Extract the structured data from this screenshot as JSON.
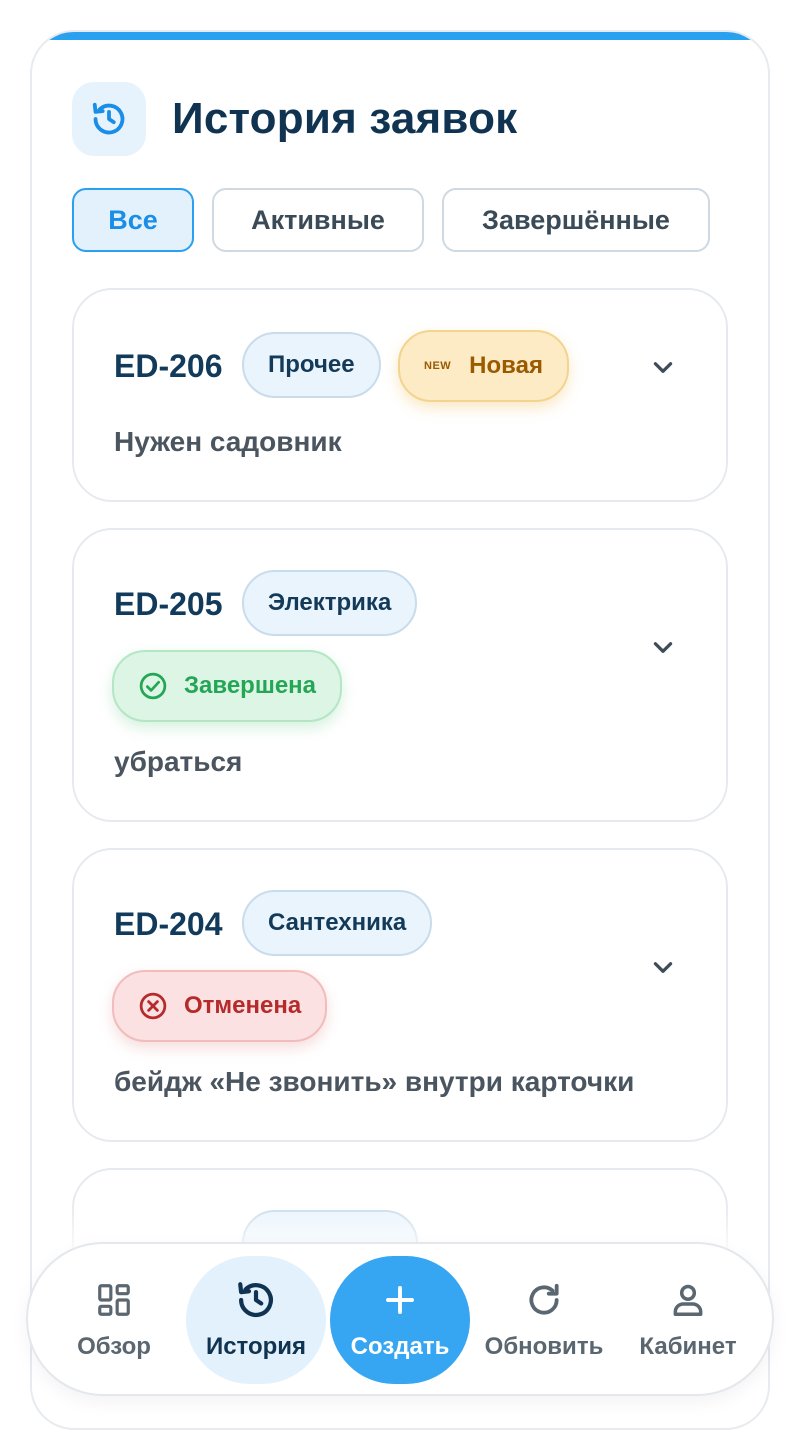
{
  "header": {
    "title": "История заявок",
    "icon": "history-icon"
  },
  "filters": [
    {
      "label": "Все",
      "active": true
    },
    {
      "label": "Активные",
      "active": false
    },
    {
      "label": "Завершённые",
      "active": false
    }
  ],
  "requests": [
    {
      "id": "ED-206",
      "category": "Прочее",
      "status": "Новая",
      "status_tag": "NEW",
      "status_type": "new",
      "description": "Нужен садовник"
    },
    {
      "id": "ED-205",
      "category": "Электрика",
      "status": "Завершена",
      "status_type": "done",
      "status_icon": "check-circle-icon",
      "description": "убраться"
    },
    {
      "id": "ED-204",
      "category": "Сантехника",
      "status": "Отменена",
      "status_type": "cancel",
      "status_icon": "x-circle-icon",
      "description": "бейдж «Не звонить» внутри карточки"
    }
  ],
  "bottom_nav": [
    {
      "label": "Обзор",
      "icon": "grid-icon"
    },
    {
      "label": "История",
      "icon": "history-icon",
      "active": true
    },
    {
      "label": "Создать",
      "icon": "plus-icon",
      "primary": true
    },
    {
      "label": "Обновить",
      "icon": "refresh-icon"
    },
    {
      "label": "Кабинет",
      "icon": "user-icon"
    }
  ],
  "colors": {
    "accent": "#2aa0f0",
    "title": "#0f3350",
    "new": "#9a5a00",
    "done": "#25a657",
    "cancel": "#b52a2a"
  }
}
